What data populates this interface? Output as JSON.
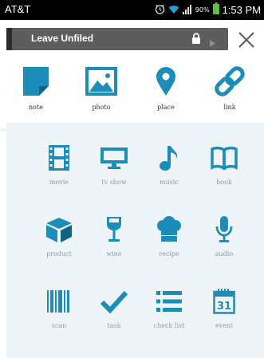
{
  "statusbar": {
    "carrier": "AT&T",
    "battery_percent": "90%",
    "time": "1:53 PM"
  },
  "titlebar": {
    "notebook_label": "Leave Unfiled"
  },
  "colors": {
    "accent": "#1c8db8",
    "panel": "#eef4f8",
    "notebook_bar": "#5d5d5d"
  },
  "top_items": [
    {
      "label": "note",
      "icon": "note-icon"
    },
    {
      "label": "photo",
      "icon": "photo-icon"
    },
    {
      "label": "place",
      "icon": "place-icon"
    },
    {
      "label": "link",
      "icon": "link-icon"
    }
  ],
  "grid_items": [
    {
      "label": "movie",
      "icon": "film-icon"
    },
    {
      "label": "tv show",
      "icon": "tv-icon"
    },
    {
      "label": "music",
      "icon": "music-note-icon"
    },
    {
      "label": "book",
      "icon": "book-icon"
    },
    {
      "label": "product",
      "icon": "box-icon"
    },
    {
      "label": "wine",
      "icon": "wine-glass-icon"
    },
    {
      "label": "recipe",
      "icon": "chef-hat-icon"
    },
    {
      "label": "audio",
      "icon": "microphone-icon"
    },
    {
      "label": "scan",
      "icon": "barcode-icon"
    },
    {
      "label": "task",
      "icon": "checkmark-icon"
    },
    {
      "label": "check list",
      "icon": "checklist-icon"
    },
    {
      "label": "event",
      "icon": "calendar-icon"
    }
  ],
  "calendar_day": "31"
}
